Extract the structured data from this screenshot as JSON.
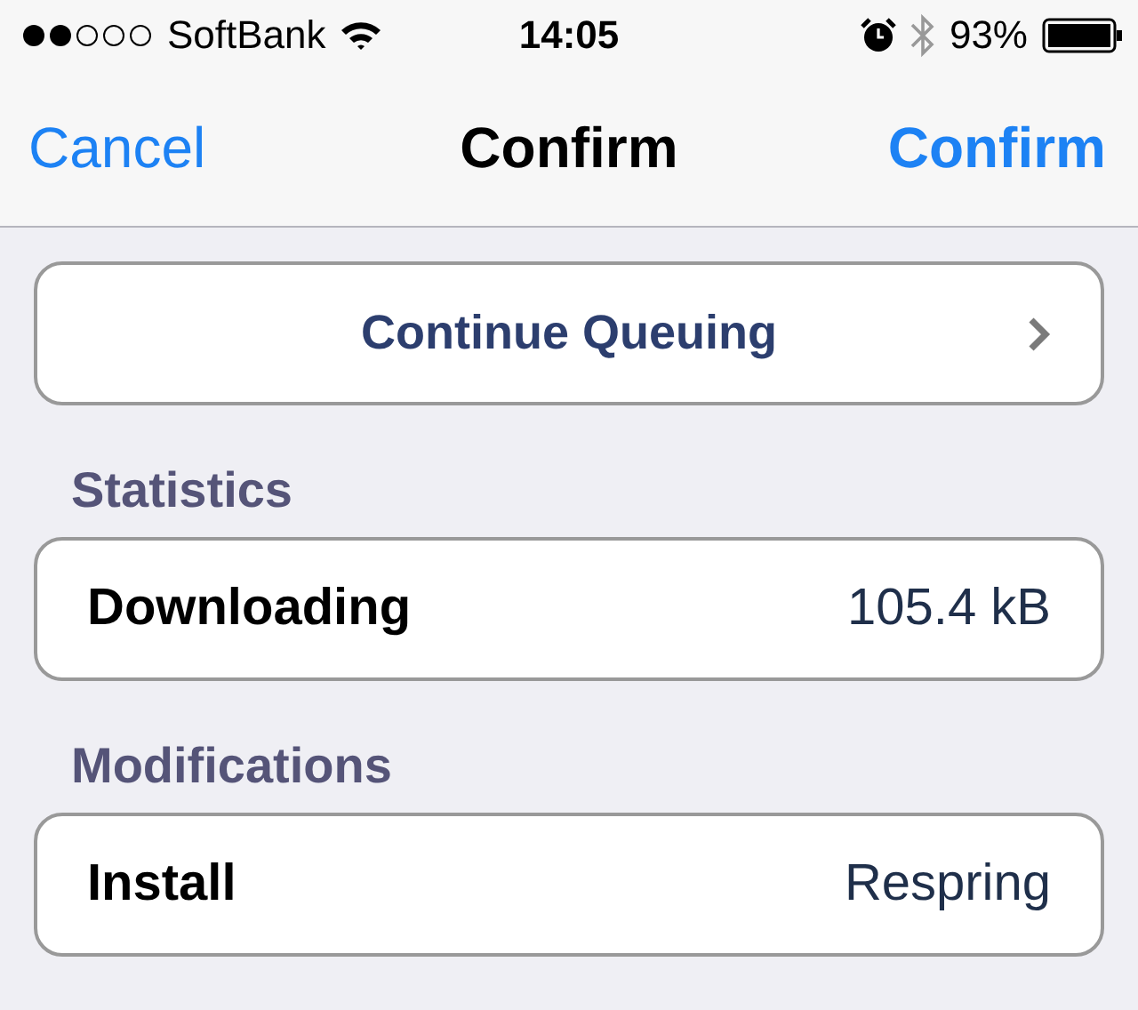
{
  "status_bar": {
    "carrier": "SoftBank",
    "time": "14:05",
    "battery": "93%"
  },
  "nav_bar": {
    "left_button": "Cancel",
    "title": "Confirm",
    "right_button": "Confirm"
  },
  "action": {
    "label": "Continue Queuing"
  },
  "sections": [
    {
      "header": "Statistics",
      "rows": [
        {
          "label": "Downloading",
          "value": "105.4 kB"
        }
      ]
    },
    {
      "header": "Modifications",
      "rows": [
        {
          "label": "Install",
          "value": "Respring"
        }
      ]
    }
  ]
}
